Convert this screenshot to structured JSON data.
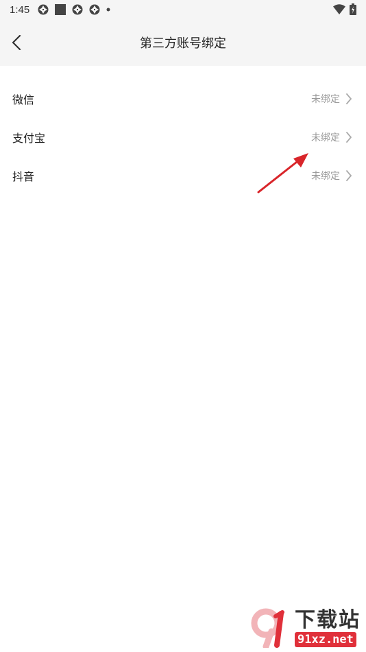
{
  "status_bar": {
    "time": "1:45",
    "icons": [
      "aperture-icon",
      "square-icon",
      "aperture-icon",
      "aperture-icon",
      "dot-icon"
    ],
    "right_icons": [
      "wifi-icon",
      "battery-icon"
    ]
  },
  "header": {
    "title": "第三方账号绑定",
    "back_icon": "chevron-left-icon"
  },
  "accounts": [
    {
      "name": "微信",
      "status": "未绑定"
    },
    {
      "name": "支付宝",
      "status": "未绑定"
    },
    {
      "name": "抖音",
      "status": "未绑定"
    }
  ],
  "colors": {
    "header_bg": "#f5f5f5",
    "status_text": "#999999",
    "arrow": "#d9252a",
    "watermark_red": "#e0303a"
  },
  "watermark": {
    "cn": "下载站",
    "url": "91xz.net"
  }
}
